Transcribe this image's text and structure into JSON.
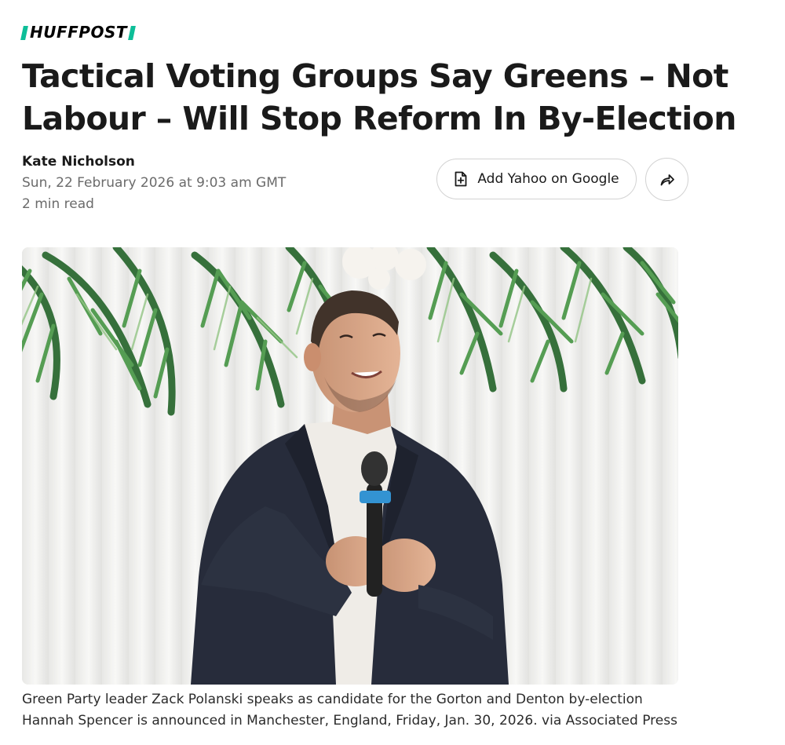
{
  "brand": {
    "logo_text": "HUFFPOST",
    "accent_color": "#0dbe98"
  },
  "article": {
    "headline": "Tactical Voting Groups Say Greens – Not Labour – Will Stop Reform In By-Election",
    "author": "Kate Nicholson",
    "date": "Sun, 22 February 2026 at 9:03 am GMT",
    "read_time": "2 min read"
  },
  "actions": {
    "add_source_label": "Add Yahoo on Google",
    "add_source_icon": "add-document-icon",
    "share_icon": "share-arrow-icon"
  },
  "photo": {
    "caption": "Green Party leader Zack Polanski speaks as candidate for the Gorton and Denton by-election Hannah Spencer is announced in Manchester, England, Friday, Jan. 30, 2026. via Associated Press"
  }
}
